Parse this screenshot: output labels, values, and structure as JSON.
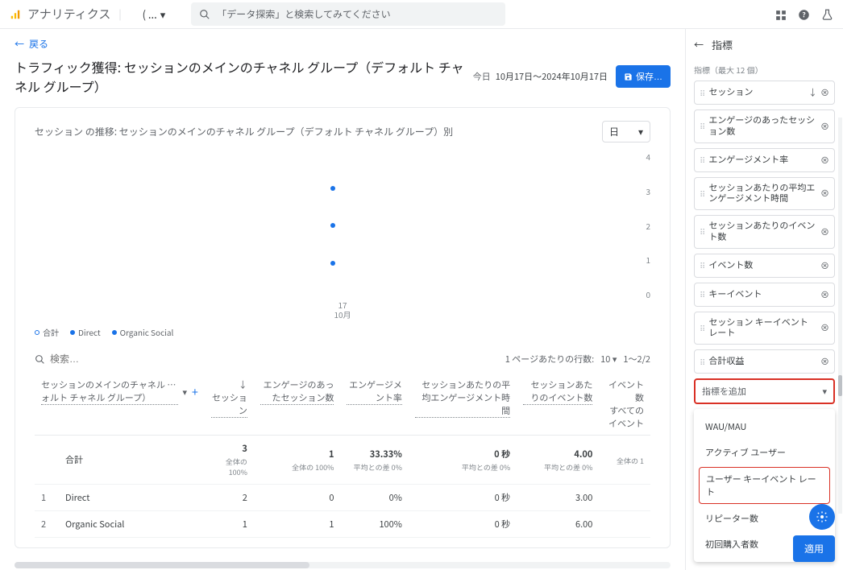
{
  "header": {
    "product": "アナリティクス",
    "account": "( ...",
    "search_placeholder": "「データ探索」と検索してみてください"
  },
  "nav": {
    "back": "戻る"
  },
  "page": {
    "title": "トラフィック獲得: セッションのメインのチャネル グループ（デフォルト チャネル グループ）",
    "date_prefix": "今日",
    "date_range": "10月17日～2024年10月17日",
    "save": "保存…"
  },
  "card": {
    "title": "セッション の推移: セッションのメインのチャネル グループ（デフォルト チャネル グループ）別",
    "granularity": "日"
  },
  "chart_data": {
    "type": "scatter",
    "x_label_top": "17",
    "x_label_bottom": "10月",
    "ylim": [
      0,
      4
    ],
    "yticks": [
      0,
      1,
      2,
      3,
      4
    ],
    "series": [
      {
        "name": "合計",
        "color": "#1a73e8",
        "points": [
          {
            "x": 0.5,
            "y": 3
          }
        ]
      },
      {
        "name": "Direct",
        "color": "#1a73e8",
        "points": [
          {
            "x": 0.5,
            "y": 2
          }
        ]
      },
      {
        "name": "Organic Social",
        "color": "#1a73e8",
        "points": [
          {
            "x": 0.5,
            "y": 1
          }
        ]
      }
    ],
    "legend": [
      {
        "label": "合計",
        "color": "#1a73e8",
        "filled": false
      },
      {
        "label": "Direct",
        "color": "#1a73e8",
        "filled": true
      },
      {
        "label": "Organic Social",
        "color": "#1a73e8",
        "filled": true
      }
    ]
  },
  "table_ctrl": {
    "search_placeholder": "検索…",
    "rows_label": "1 ページあたりの行数:",
    "rows_value": "10",
    "page": "1～2/2"
  },
  "table": {
    "dim_header": "セッションのメインのチャネル …ォルト チャネル グループ）",
    "columns": [
      "セッション",
      "エンゲージのあったセッション数",
      "エンゲージメント率",
      "セッションあたりの平均エンゲージメント時間",
      "セッションあたりのイベント数",
      "イベント数\nすべてのイベント"
    ],
    "totals_label": "合計",
    "totals": [
      "3",
      "1",
      "33.33%",
      "0 秒",
      "4.00",
      ""
    ],
    "totals_sub": [
      "全体の 100%",
      "全体の 100%",
      "平均との差 0%",
      "平均との差 0%",
      "平均との差 0%",
      "全体の 1"
    ],
    "rows": [
      {
        "idx": "1",
        "dim": "Direct",
        "v": [
          "2",
          "0",
          "0%",
          "0 秒",
          "3.00",
          ""
        ]
      },
      {
        "idx": "2",
        "dim": "Organic Social",
        "v": [
          "1",
          "1",
          "100%",
          "0 秒",
          "6.00",
          ""
        ]
      }
    ]
  },
  "side": {
    "title": "指標",
    "limit": "指標（最大 12 個）",
    "metrics": [
      "セッション",
      "エンゲージのあったセッション数",
      "エンゲージメント率",
      "セッションあたりの平均エンゲージメント時間",
      "セッションあたりのイベント数",
      "イベント数",
      "キーイベント",
      "セッション キーイベント レート",
      "合計収益"
    ],
    "add_label": "指標を追加",
    "options": [
      "WAU/MAU",
      "アクティブ ユーザー",
      "ユーザー キーイベント レート",
      "リピーター数",
      "初回購入者数"
    ],
    "apply": "適用"
  }
}
